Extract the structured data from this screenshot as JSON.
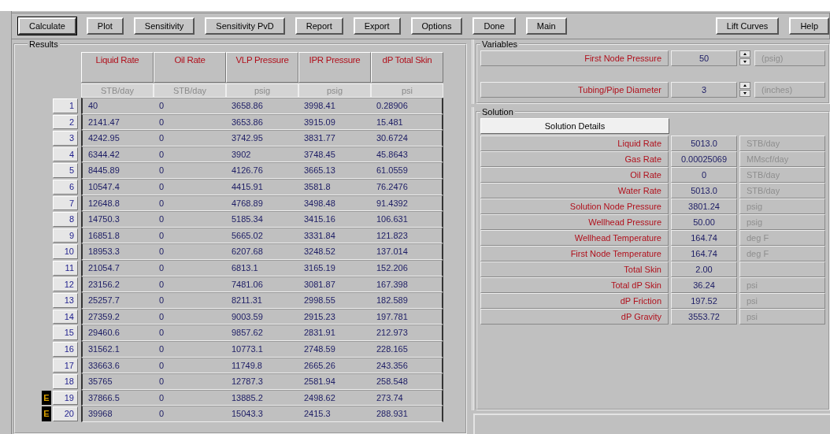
{
  "toolbar": {
    "left_buttons": [
      {
        "label": "Calculate",
        "default": true
      },
      {
        "label": "Plot",
        "default": false
      },
      {
        "label": "Sensitivity",
        "default": false
      },
      {
        "label": "Sensitivity PvD",
        "default": false
      },
      {
        "label": "Report",
        "default": false
      },
      {
        "label": "Export",
        "default": false
      },
      {
        "label": "Options",
        "default": false
      },
      {
        "label": "Done",
        "default": false
      },
      {
        "label": "Main",
        "default": false
      }
    ],
    "right_buttons": [
      {
        "label": "Lift Curves",
        "default": false
      },
      {
        "label": "Help",
        "default": false
      }
    ]
  },
  "results": {
    "title": "Results",
    "columns": [
      {
        "name": "Liquid Rate",
        "unit": "STB/day"
      },
      {
        "name": "Oil Rate",
        "unit": "STB/day"
      },
      {
        "name": "VLP Pressure",
        "unit": "psig"
      },
      {
        "name": "IPR Pressure",
        "unit": "psig"
      },
      {
        "name": "dP Total Skin",
        "unit": "psi"
      }
    ],
    "rows": [
      {
        "index": "1",
        "cells": [
          "40",
          "0",
          "3658.86",
          "3998.41",
          "0.28906"
        ]
      },
      {
        "index": "2",
        "cells": [
          "2141.47",
          "0",
          "3653.86",
          "3915.09",
          "15.481"
        ]
      },
      {
        "index": "3",
        "cells": [
          "4242.95",
          "0",
          "3742.95",
          "3831.77",
          "30.6724"
        ]
      },
      {
        "index": "4",
        "cells": [
          "6344.42",
          "0",
          "3902",
          "3748.45",
          "45.8643"
        ]
      },
      {
        "index": "5",
        "cells": [
          "8445.89",
          "0",
          "4126.76",
          "3665.13",
          "61.0559"
        ]
      },
      {
        "index": "6",
        "cells": [
          "10547.4",
          "0",
          "4415.91",
          "3581.8",
          "76.2476"
        ]
      },
      {
        "index": "7",
        "cells": [
          "12648.8",
          "0",
          "4768.89",
          "3498.48",
          "91.4392"
        ]
      },
      {
        "index": "8",
        "cells": [
          "14750.3",
          "0",
          "5185.34",
          "3415.16",
          "106.631"
        ]
      },
      {
        "index": "9",
        "cells": [
          "16851.8",
          "0",
          "5665.02",
          "3331.84",
          "121.823"
        ]
      },
      {
        "index": "10",
        "cells": [
          "18953.3",
          "0",
          "6207.68",
          "3248.52",
          "137.014"
        ]
      },
      {
        "index": "11",
        "cells": [
          "21054.7",
          "0",
          "6813.1",
          "3165.19",
          "152.206"
        ]
      },
      {
        "index": "12",
        "cells": [
          "23156.2",
          "0",
          "7481.06",
          "3081.87",
          "167.398"
        ]
      },
      {
        "index": "13",
        "cells": [
          "25257.7",
          "0",
          "8211.31",
          "2998.55",
          "182.589"
        ]
      },
      {
        "index": "14",
        "cells": [
          "27359.2",
          "0",
          "9003.59",
          "2915.23",
          "197.781"
        ]
      },
      {
        "index": "15",
        "cells": [
          "29460.6",
          "0",
          "9857.62",
          "2831.91",
          "212.973"
        ]
      },
      {
        "index": "16",
        "cells": [
          "31562.1",
          "0",
          "10773.1",
          "2748.59",
          "228.165"
        ]
      },
      {
        "index": "17",
        "cells": [
          "33663.6",
          "0",
          "11749.8",
          "2665.26",
          "243.356"
        ]
      },
      {
        "index": "18",
        "cells": [
          "35765",
          "0",
          "12787.3",
          "2581.94",
          "258.548"
        ]
      },
      {
        "index": "19",
        "marker": "E",
        "cells": [
          "37866.5",
          "0",
          "13885.2",
          "2498.62",
          "273.74"
        ]
      },
      {
        "index": "20",
        "marker": "E",
        "cells": [
          "39968",
          "0",
          "15043.3",
          "2415.3",
          "288.931"
        ]
      }
    ]
  },
  "variables": {
    "title": "Variables",
    "items": [
      {
        "label": "First Node Pressure",
        "value": "50",
        "unit": "(psig)"
      },
      {
        "label": "Tubing/Pipe Diameter",
        "value": "3",
        "unit": "(inches)"
      }
    ]
  },
  "solution": {
    "title": "Solution",
    "details_button": "Solution Details",
    "rows": [
      {
        "label": "Liquid Rate",
        "value": "5013.0",
        "unit": "STB/day"
      },
      {
        "label": "Gas Rate",
        "value": "0.00025069",
        "unit": "MMscf/day"
      },
      {
        "label": "Oil Rate",
        "value": "0",
        "unit": "STB/day"
      },
      {
        "label": "Water Rate",
        "value": "5013.0",
        "unit": "STB/day"
      },
      {
        "label": "Solution Node Pressure",
        "value": "3801.24",
        "unit": "psig"
      },
      {
        "label": "Wellhead Pressure",
        "value": "50.00",
        "unit": "psig"
      },
      {
        "label": "Wellhead Temperature",
        "value": "164.74",
        "unit": "deg F"
      },
      {
        "label": "First Node Temperature",
        "value": "164.74",
        "unit": "deg F"
      },
      {
        "label": "Total Skin",
        "value": "2.00"
      },
      {
        "label": "Total dP Skin",
        "value": "36.24",
        "unit": "psi"
      },
      {
        "label": "dP Friction",
        "value": "197.52",
        "unit": "psi"
      },
      {
        "label": "dP Gravity",
        "value": "3553.72",
        "unit": "psi"
      }
    ]
  }
}
